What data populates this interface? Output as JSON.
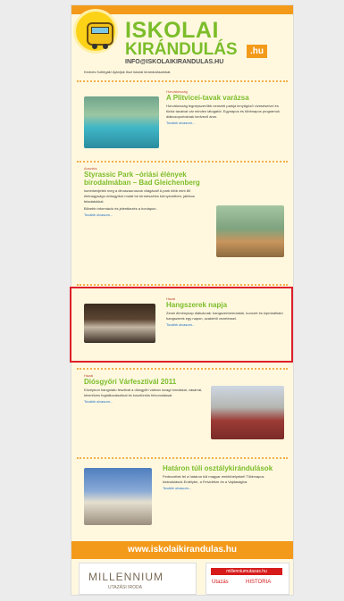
{
  "header": {
    "brand_line1": "ISKOLAI",
    "brand_line2": "KIRÁNDULÁS",
    "brand_suffix": ".hu",
    "email": "INFO@ISKOLAIKIRANDULAS.HU",
    "intro": "Kedves Kollégák! Ajánljuk őszi iskolai kirándulásainkat."
  },
  "articles": [
    {
      "kicker": "Horvátország",
      "title": "A Plitvicei-tavak varázsa",
      "body": "Horvátország legnépszerűbb nemzeti parkja lenyűgöző vízeséseivel és türkiz tavaival vár minden látogatót. Egynapos és többnapos programok diákcsoportoknak kedvező áron.",
      "more": "Tovább olvasom..."
    },
    {
      "kicker": "Ausztria",
      "title": "Styrassic Park –óriási élények birodalmában – Bad Gleichenberg",
      "body": "Ismerkedjetek meg a dinoszauruszok világával! A park több mint 80 életnagyságú óriásgyíkot mutat be természetes környezetben, játékos feladatokkal.",
      "note": "Bővebb információ és jelentkezés a honlapon.",
      "more": "Tovább olvasom..."
    },
    {
      "kicker": "Hazai",
      "title": "Hangszerek napja",
      "body": "Zenei élménynap diákoknak: hangszerbemutatók, koncert és kipróbálható hangszerek egy napon, szakértő vezetéssel.",
      "more": "Tovább olvasom..."
    },
    {
      "kicker": "Hazai",
      "title": "Diósgyőri Várfesztivál 2011",
      "body": "Középkori hangulatú fesztivál a diósgyőri várban lovagi tornákkal, vásárral, kézműves foglalkozásokkal és kosztümös felvonulással.",
      "more": "Tovább olvasom..."
    },
    {
      "kicker": "",
      "title": "Határon túli osztálykirándulások",
      "body": "Fedezzétek fel a határon túli magyar emlékhelyeket! Többnapos kirándulások Erdélybe, a Felvidékre és a Vajdaságba.",
      "more": "Tovább olvasom..."
    }
  ],
  "footer": {
    "url": "www.iskolaikirandulas.hu",
    "ad1_main": "MILLENNIUM",
    "ad1_sub": "UTAZÁSI IRODA",
    "ad2_top": "millenniumutazas.hu",
    "ad2_a": "Utazás",
    "ad2_b": "HISTORIA"
  },
  "colors": {
    "accent_orange": "#f39a1b",
    "accent_green": "#7bbd2a",
    "highlight_red": "#dd1f2a"
  }
}
